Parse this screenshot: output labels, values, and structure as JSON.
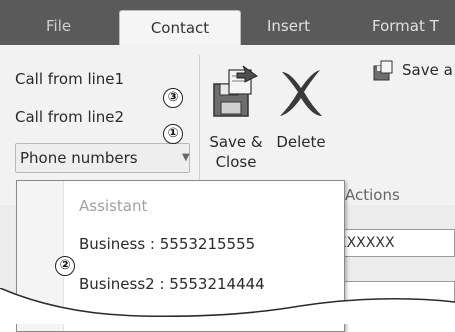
{
  "tabs": {
    "file": "File",
    "contact": "Contact",
    "insert": "Insert",
    "format": "Format T"
  },
  "ribbon": {
    "call_line1": "Call from line1",
    "call_line2": "Call from line2",
    "phone_numbers": "Phone numbers",
    "save_close_line1": "Save &",
    "save_close_line2": "Close",
    "delete": "Delete",
    "save_and": "Save a",
    "actions_group": "Actions"
  },
  "callouts": {
    "c1": "①",
    "c2": "②",
    "c3": "③"
  },
  "dropdown": {
    "items": [
      {
        "label": "Assistant",
        "enabled": false
      },
      {
        "label": "Business : 5553215555",
        "enabled": true
      },
      {
        "label": "Business2 : 5553214444",
        "enabled": true
      }
    ]
  },
  "form": {
    "field1_value": "XXXXXX"
  },
  "colors": {
    "tabstrip": "#5a5a5a",
    "ribbon": "#f2f2f2",
    "delete_x": "#3a3a3a"
  }
}
